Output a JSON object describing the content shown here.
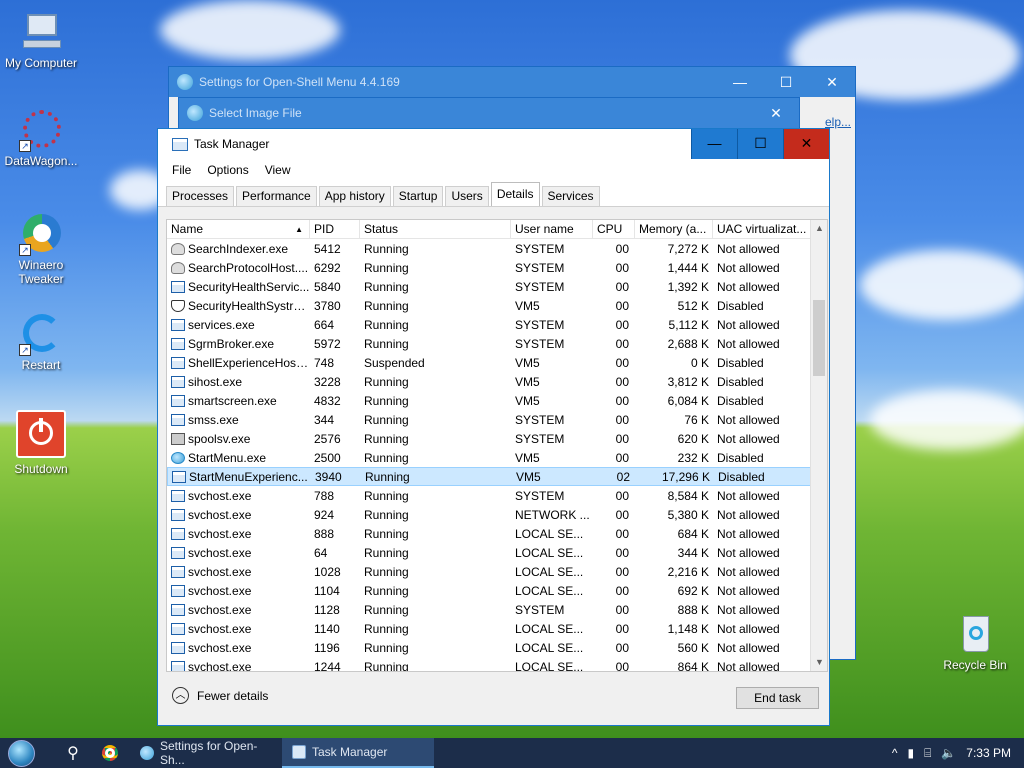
{
  "desktop": {
    "icons": [
      {
        "label": "My Computer"
      },
      {
        "label": "DataWagon..."
      },
      {
        "label": "Winaero Tweaker"
      },
      {
        "label": "Restart"
      },
      {
        "label": "Shutdown"
      },
      {
        "label": "Recycle Bin"
      }
    ]
  },
  "bg_windows": {
    "settings_title": "Settings for Open-Shell Menu 4.4.169",
    "select_image_title": "Select Image File",
    "help_fragment": "elp..."
  },
  "task_manager": {
    "title": "Task Manager",
    "menu": [
      "File",
      "Options",
      "View"
    ],
    "tabs": [
      "Processes",
      "Performance",
      "App history",
      "Startup",
      "Users",
      "Details",
      "Services"
    ],
    "active_tab": "Details",
    "columns": [
      "Name",
      "PID",
      "Status",
      "User name",
      "CPU",
      "Memory (a...",
      "UAC virtualizat..."
    ],
    "rows": [
      {
        "name": "SearchIndexer.exe",
        "pid": "5412",
        "status": "Running",
        "user": "SYSTEM",
        "cpu": "00",
        "mem": "7,272 K",
        "uac": "Not allowed",
        "icon": "user"
      },
      {
        "name": "SearchProtocolHost....",
        "pid": "6292",
        "status": "Running",
        "user": "SYSTEM",
        "cpu": "00",
        "mem": "1,444 K",
        "uac": "Not allowed",
        "icon": "user"
      },
      {
        "name": "SecurityHealthServic...",
        "pid": "5840",
        "status": "Running",
        "user": "SYSTEM",
        "cpu": "00",
        "mem": "1,392 K",
        "uac": "Not allowed",
        "icon": "window"
      },
      {
        "name": "SecurityHealthSystra...",
        "pid": "3780",
        "status": "Running",
        "user": "VM5",
        "cpu": "00",
        "mem": "512 K",
        "uac": "Disabled",
        "icon": "shield"
      },
      {
        "name": "services.exe",
        "pid": "664",
        "status": "Running",
        "user": "SYSTEM",
        "cpu": "00",
        "mem": "5,112 K",
        "uac": "Not allowed",
        "icon": "window"
      },
      {
        "name": "SgrmBroker.exe",
        "pid": "5972",
        "status": "Running",
        "user": "SYSTEM",
        "cpu": "00",
        "mem": "2,688 K",
        "uac": "Not allowed",
        "icon": "window"
      },
      {
        "name": "ShellExperienceHost....",
        "pid": "748",
        "status": "Suspended",
        "user": "VM5",
        "cpu": "00",
        "mem": "0 K",
        "uac": "Disabled",
        "icon": "window"
      },
      {
        "name": "sihost.exe",
        "pid": "3228",
        "status": "Running",
        "user": "VM5",
        "cpu": "00",
        "mem": "3,812 K",
        "uac": "Disabled",
        "icon": "window"
      },
      {
        "name": "smartscreen.exe",
        "pid": "4832",
        "status": "Running",
        "user": "VM5",
        "cpu": "00",
        "mem": "6,084 K",
        "uac": "Disabled",
        "icon": "window"
      },
      {
        "name": "smss.exe",
        "pid": "344",
        "status": "Running",
        "user": "SYSTEM",
        "cpu": "00",
        "mem": "76 K",
        "uac": "Not allowed",
        "icon": "window"
      },
      {
        "name": "spoolsv.exe",
        "pid": "2576",
        "status": "Running",
        "user": "SYSTEM",
        "cpu": "00",
        "mem": "620 K",
        "uac": "Not allowed",
        "icon": "printer"
      },
      {
        "name": "StartMenu.exe",
        "pid": "2500",
        "status": "Running",
        "user": "VM5",
        "cpu": "00",
        "mem": "232 K",
        "uac": "Disabled",
        "icon": "globe"
      },
      {
        "name": "StartMenuExperienc...",
        "pid": "3940",
        "status": "Running",
        "user": "VM5",
        "cpu": "02",
        "mem": "17,296 K",
        "uac": "Disabled",
        "icon": "window",
        "selected": true
      },
      {
        "name": "svchost.exe",
        "pid": "788",
        "status": "Running",
        "user": "SYSTEM",
        "cpu": "00",
        "mem": "8,584 K",
        "uac": "Not allowed",
        "icon": "window"
      },
      {
        "name": "svchost.exe",
        "pid": "924",
        "status": "Running",
        "user": "NETWORK ...",
        "cpu": "00",
        "mem": "5,380 K",
        "uac": "Not allowed",
        "icon": "window"
      },
      {
        "name": "svchost.exe",
        "pid": "888",
        "status": "Running",
        "user": "LOCAL SE...",
        "cpu": "00",
        "mem": "684 K",
        "uac": "Not allowed",
        "icon": "window"
      },
      {
        "name": "svchost.exe",
        "pid": "64",
        "status": "Running",
        "user": "LOCAL SE...",
        "cpu": "00",
        "mem": "344 K",
        "uac": "Not allowed",
        "icon": "window"
      },
      {
        "name": "svchost.exe",
        "pid": "1028",
        "status": "Running",
        "user": "LOCAL SE...",
        "cpu": "00",
        "mem": "2,216 K",
        "uac": "Not allowed",
        "icon": "window"
      },
      {
        "name": "svchost.exe",
        "pid": "1104",
        "status": "Running",
        "user": "LOCAL SE...",
        "cpu": "00",
        "mem": "692 K",
        "uac": "Not allowed",
        "icon": "window"
      },
      {
        "name": "svchost.exe",
        "pid": "1128",
        "status": "Running",
        "user": "SYSTEM",
        "cpu": "00",
        "mem": "888 K",
        "uac": "Not allowed",
        "icon": "window"
      },
      {
        "name": "svchost.exe",
        "pid": "1140",
        "status": "Running",
        "user": "LOCAL SE...",
        "cpu": "00",
        "mem": "1,148 K",
        "uac": "Not allowed",
        "icon": "window"
      },
      {
        "name": "svchost.exe",
        "pid": "1196",
        "status": "Running",
        "user": "LOCAL SE...",
        "cpu": "00",
        "mem": "560 K",
        "uac": "Not allowed",
        "icon": "window"
      },
      {
        "name": "svchost.exe",
        "pid": "1244",
        "status": "Running",
        "user": "LOCAL SE...",
        "cpu": "00",
        "mem": "864 K",
        "uac": "Not allowed",
        "icon": "window"
      }
    ],
    "fewer_details": "Fewer details",
    "end_task": "End task"
  },
  "taskbar": {
    "apps": [
      {
        "label": "Settings for Open-Sh...",
        "active": false
      },
      {
        "label": "Task Manager",
        "active": true
      }
    ],
    "clock": "7:33 PM"
  },
  "colors": {
    "accent": "#1979ca",
    "selection": "#cce8ff",
    "close": "#c42b1c",
    "taskbar": "#1c2d4a"
  }
}
